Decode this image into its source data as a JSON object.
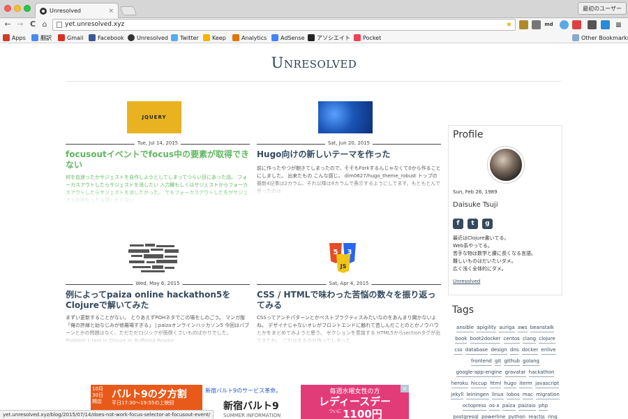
{
  "browser": {
    "tab_title": "Unresolved",
    "tab_close": "×",
    "profile_button": "最初のユーザー",
    "url": "yet.unresolved.xyz",
    "ext_md": "md",
    "back": "←",
    "forward": "→",
    "reload": "C",
    "home": "⌂",
    "star": "★",
    "menu": "≡",
    "bookmarks": [
      {
        "label": "Apps",
        "color": "#d03a2a"
      },
      {
        "label": "翻訳",
        "color": "#4a89f0"
      },
      {
        "label": "Gmail",
        "color": "#d93025"
      },
      {
        "label": "Facebook",
        "color": "#3b5998"
      },
      {
        "label": "Unresolved",
        "color": "#333333"
      },
      {
        "label": "Twitter",
        "color": "#55acee"
      },
      {
        "label": "Keep",
        "color": "#f6b400"
      },
      {
        "label": "Analytics",
        "color": "#e37400"
      },
      {
        "label": "AdSense",
        "color": "#4285f4"
      },
      {
        "label": "アソシエイト",
        "color": "#222222"
      },
      {
        "label": "Pocket",
        "color": "#ef4056"
      }
    ],
    "other_bookmarks": "Other Bookmarks",
    "status_url": "yet.unresolved.xyz/blog/2015/07/14/does-not-work-focus-selector-at-focusout-event/"
  },
  "site": {
    "title": "Unresolved"
  },
  "posts": [
    {
      "thumb_text": "JQUERY",
      "date": "Tue, Jul 14, 2015",
      "title": "focusoutイベントでfocus中の要素が取得できない",
      "excerpt": "何を血迷ったかサジェストを自作しようとしてしまってつらい目にあった話。 フォーカスアウトしたらサジェストを消したい 入力欄もしくはサジェストからフォーカスアウトしたらサジェストを消したかった。 でもフォーカスアウトした先がサジェストの中だったら消したくない"
    },
    {
      "date": "Sat, Jun 20, 2015",
      "title": "Hugo向けの新しいテーマを作った",
      "excerpt": "前に作ったやつが飽きてしまったので、そそもForkするんじゃなくて0から作ることにしました。 出来たもの こんな感じ。 dim0627/hugo_theme_robust トップの最新4記事は2カラム、それ以降は4カラムで表示するようにしてます。もともとんで思ったのは"
    },
    {
      "date": "Wed, May 6, 2015",
      "title": "例によってpaiza online hackathon5をClojureで解いてみた",
      "excerpt": "まずい更新することがない。 とりあえずPOHネタでこの場をしのごう。 マンガ版「俺の許嫁と幼なじみが修羅場すぎる」 | paizaオンラインハッカソン5 今回はバブーンとかの問題はなく、ただただロジックが面倒くさいものばかりでした。 Problem 1 text in Clojure in_Buffered Reader"
    },
    {
      "thumb_text": "5 3",
      "date": "Sat, Apr 4, 2015",
      "title": "CSS / HTMLで味わった苦悩の数々を振り返ってみる",
      "excerpt": "CSSってアンチパターンとかベストプラクティスみたいなのをあんまり聞かないよね。 デザイナじゃないオレがフロントエンドに触れて苦しんだことのとかノウハウとかをまとめてみようと思う。 セクションを意識する HTML5からsectionタグが出てきたわ。 これはをるのか作ってしまった"
    }
  ],
  "profile": {
    "heading": "Profile",
    "birth": "Sun, Feb 26, 1989",
    "name": "Daisuke Tsuji",
    "social": [
      {
        "icon": "facebook-icon",
        "glyph": "f"
      },
      {
        "icon": "twitter-icon",
        "glyph": "t"
      },
      {
        "icon": "github-icon",
        "glyph": "g"
      }
    ],
    "bio": [
      "最近はClojure書いてる。",
      "Web系やってる。",
      "苦手な物は数学と腰に長くなる言語。",
      "難しいものはだいたいダメ。",
      "広く浅く全体的にダメ。"
    ],
    "more": "Unresolved"
  },
  "tags": {
    "heading": "Tags",
    "items": [
      "ansible",
      "apigility",
      "auriga",
      "aws",
      "beanstalk",
      "book",
      "boot2docker",
      "centos",
      "clang",
      "clojure",
      "css",
      "database",
      "design",
      "dns",
      "docker",
      "enlive",
      "frontend",
      "git",
      "github",
      "golang",
      "google-app-engine",
      "gravatar",
      "hackathon",
      "heroku",
      "hiccup",
      "html",
      "hugo",
      "iterm",
      "javascript",
      "jekyll",
      "leiningen",
      "linux",
      "lobos",
      "mac",
      "migration",
      "octopress",
      "os-x",
      "paiza",
      "paizaio",
      "php",
      "postgresql",
      "powerline",
      "python",
      "reactjs",
      "ring"
    ]
  },
  "ad": {
    "a_side": "10月 30日 開店",
    "a_big": "バルト9の夕方割",
    "a_small": "平日17:30～19:55の上映回",
    "b_top": "新宿バルト9のサービス革命。",
    "b_big": "新宿バルト9",
    "b_sub": "SUMMER INFORMATION",
    "c_top": "毎週水曜女性の方",
    "c_big": "レディースデー",
    "c_small": "ついに",
    "c_price": "1100円",
    "close": "×"
  },
  "colors": {
    "title": "#2d3e5a",
    "highlight": "#5fb85f",
    "link": "#34495e"
  }
}
